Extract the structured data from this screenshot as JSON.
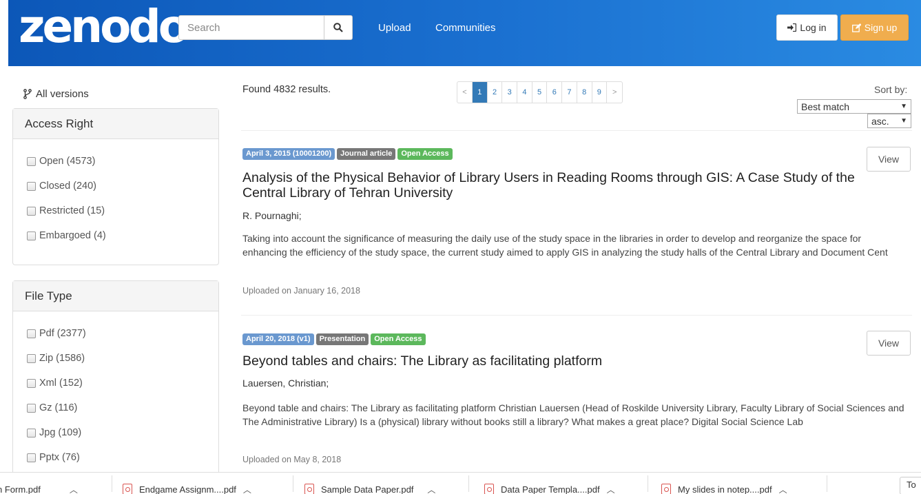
{
  "header": {
    "logo": "zenodo",
    "search_placeholder": "Search",
    "nav": [
      "Upload",
      "Communities"
    ],
    "login_label": "Log in",
    "signup_label": "Sign up"
  },
  "sidebar": {
    "all_versions": "All versions",
    "access_right": {
      "title": "Access Right",
      "items": [
        "Open (4573)",
        "Closed (240)",
        "Restricted (15)",
        "Embargoed (4)"
      ]
    },
    "file_type": {
      "title": "File Type",
      "items": [
        "Pdf (2377)",
        "Zip (1586)",
        "Xml (152)",
        "Gz (116)",
        "Jpg (109)",
        "Pptx (76)"
      ]
    }
  },
  "results": {
    "found": "Found 4832 results.",
    "pages": [
      "<",
      "1",
      "2",
      "3",
      "4",
      "5",
      "6",
      "7",
      "8",
      "9",
      ">"
    ],
    "active_page": "1",
    "sort_label": "Sort by:",
    "sort_value": "Best match",
    "order_value": "asc."
  },
  "records": [
    {
      "date": "April 3, 2015 (10001200)",
      "type": "Journal article",
      "access": "Open Access",
      "title": "Analysis of the Physical Behavior of Library Users in Reading Rooms through GIS: A Case Study of the Central Library of Tehran University",
      "authors": "R. Pournaghi;",
      "description": "Taking into account the significance of measuring the daily use of the study space in the libraries in order to develop and reorganize the space for enhancing the efficiency of the study space, the current study aimed to apply GIS in analyzing the study halls of the Central Library and Document Cent",
      "uploaded": "Uploaded on January 16, 2018",
      "view_label": "View"
    },
    {
      "date": "April 20, 2018 (v1)",
      "type": "Presentation",
      "access": "Open Access",
      "title": "Beyond tables and chairs: The Library as facilitating platform",
      "authors": "Lauersen, Christian;",
      "description": "Beyond table and chairs: The Library as facilitating platform Christian Lauersen (Head of Roskilde University Library, Faculty Library of Social Sciences and The Administrative Library) Is a (physical) library without books still a library? What makes a great place? Digital Social Science Lab",
      "uploaded": "Uploaded on May 8, 2018",
      "view_label": "View"
    }
  ],
  "downloads": {
    "items": [
      "n Form.pdf",
      "Endgame Assignm....pdf",
      "Sample Data Paper.pdf",
      "Data Paper Templa....pdf",
      "My slides in notep....pdf"
    ],
    "show_all": "To"
  },
  "colors": {
    "header_start": "#0c57b8",
    "header_end": "#2a8be2",
    "signup": "#f0ad4e",
    "badge_date": "#6a98cf",
    "badge_type": "#777777",
    "badge_open": "#5cb85c",
    "link": "#337ab7"
  }
}
